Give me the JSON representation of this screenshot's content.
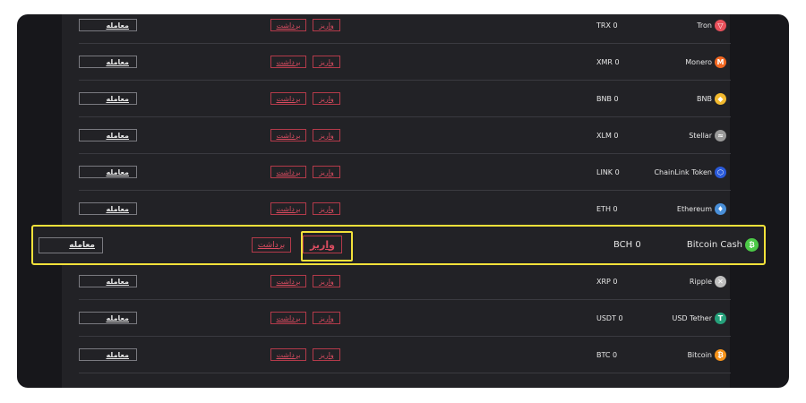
{
  "labels": {
    "deposit": "واریز",
    "withdraw": "برداشت",
    "trade": "معامله"
  },
  "rows": [
    {
      "name": "Tron",
      "balance": "TRX 0",
      "icon": "tron-icon",
      "color": "#e8505b"
    },
    {
      "name": "Monero",
      "balance": "XMR 0",
      "icon": "monero-icon",
      "color": "#f26822"
    },
    {
      "name": "BNB",
      "balance": "BNB 0",
      "icon": "bnb-icon",
      "color": "#f3ba2f"
    },
    {
      "name": "Stellar",
      "balance": "XLM 0",
      "icon": "stellar-icon",
      "color": "#9a9a9a"
    },
    {
      "name": "ChainLink Token",
      "balance": "LINK 0",
      "icon": "chainlink-icon",
      "color": "#2a5ada"
    },
    {
      "name": "Ethereum",
      "balance": "ETH 0",
      "icon": "ethereum-icon",
      "color": "#4a90d9"
    },
    {
      "name": "Bitcoin Cash",
      "balance": "BCH 0",
      "icon": "bitcoin-cash-icon",
      "color": "#4cca47"
    },
    {
      "name": "Ripple",
      "balance": "XRP 0",
      "icon": "ripple-icon",
      "color": "#bfbfbf"
    },
    {
      "name": "USD Tether",
      "balance": "USDT 0",
      "icon": "tether-icon",
      "color": "#26a17b"
    },
    {
      "name": "Bitcoin",
      "balance": "BTC 0",
      "icon": "bitcoin-icon",
      "color": "#f7931a"
    }
  ],
  "highlighted_row_index": 6
}
